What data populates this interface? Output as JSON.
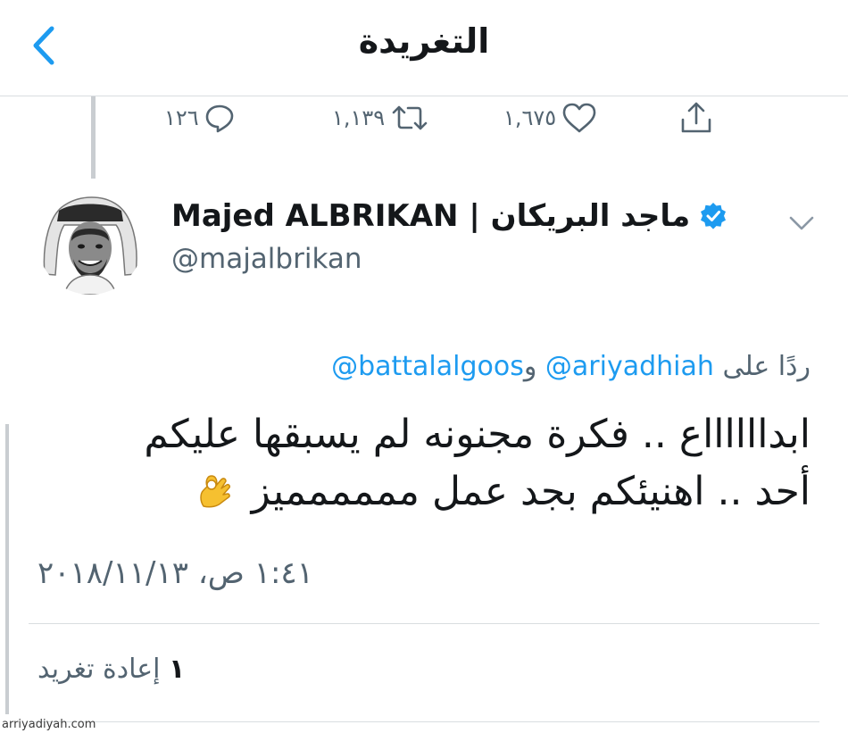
{
  "header": {
    "title": "التغريدة",
    "back_icon": "chevron-left-icon"
  },
  "previous_tweet_actions": {
    "reply_count": "١٢٦",
    "retweet_count": "١,١٣٩",
    "like_count": "١,٦٧٥"
  },
  "author": {
    "display_name": "Majed ALBRIKAN | ماجد البريكان",
    "handle": "@majalbrikan",
    "verified": true
  },
  "reply_to": {
    "prefix": "ردًا على",
    "mention_1": "@ariyadhiah",
    "connector": "و",
    "mention_2": "@battalalgoos"
  },
  "tweet": {
    "line_1": "ابدااااااع .. فكرة مجنونه لم يسبقها عليكم",
    "line_2": "أحد .. اهنيئكم بجد عمل مممممميز",
    "emoji": "ok-hand-emoji",
    "timestamp": "١:٤١ ص، ٢٠١٨/١١/١٣"
  },
  "stats": {
    "retweets_count": "١",
    "retweets_label": "إعادة تغريد"
  },
  "watermark": "arriyadiyah.com",
  "colors": {
    "link_blue": "#1d9bf0",
    "secondary_text": "#536471",
    "divider": "#d9dde0"
  }
}
